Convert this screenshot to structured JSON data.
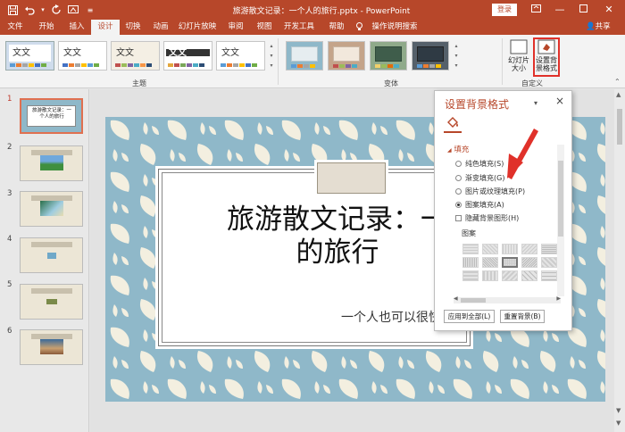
{
  "titlebar": {
    "title": "旅游散文记录：一个人的旅行.pptx  -  PowerPoint",
    "login": "登录",
    "qat_icons": [
      "save-icon",
      "undo-icon",
      "redo-icon",
      "start-from-beginning-icon",
      "customize-qat-icon"
    ]
  },
  "tabs": [
    "文件",
    "开始",
    "插入",
    "设计",
    "切换",
    "动画",
    "幻灯片放映",
    "审阅",
    "视图",
    "开发工具",
    "帮助"
  ],
  "active_tab": "设计",
  "tell_me": "操作说明搜索",
  "share": "共享",
  "ribbon": {
    "themes_group_label": "主题",
    "variants_group_label": "变体",
    "customize_group_label": "自定义",
    "theme_sample_text": "文文",
    "theme_sample_text_b": "文文",
    "theme_sample_text_c": "文文",
    "theme_sample_text_d": "文文",
    "theme_sample_text_e": "文文",
    "theme_sample_text_f": "文文",
    "slide_size_label": "幻灯片\n大小",
    "format_background_label": "设置背\n景格式"
  },
  "thumbnails": [
    {
      "num": "1",
      "caption": "旅游散文记录：一个人的旅行",
      "selected": true
    },
    {
      "num": "2"
    },
    {
      "num": "3"
    },
    {
      "num": "4"
    },
    {
      "num": "5"
    },
    {
      "num": "6"
    }
  ],
  "slide": {
    "title": "旅游散文记录：一\n的旅行",
    "subtitle": "一个人也可以很快乐"
  },
  "format_pane": {
    "title": "设置背景格式",
    "section": "填充",
    "options": [
      {
        "label": "纯色填充(S)",
        "checked": false
      },
      {
        "label": "渐变填充(G)",
        "checked": false
      },
      {
        "label": "图片或纹理填充(P)",
        "checked": false
      },
      {
        "label": "图案填充(A)",
        "checked": true
      }
    ],
    "hide_graphics": "隐藏背景图形(H)",
    "pattern_label": "图案",
    "apply_all": "应用到全部(L)",
    "reset": "重置背景(B)"
  },
  "colors": {
    "accent": "#b7472a",
    "slide_background": "#8fb8c9",
    "highlight": "#e0312a"
  }
}
